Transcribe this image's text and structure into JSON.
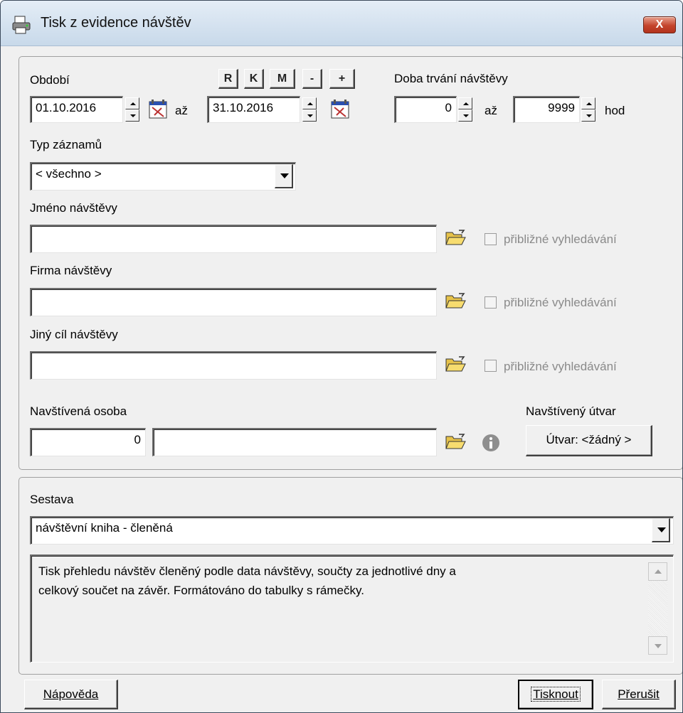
{
  "window": {
    "title": "Tisk z evidence návštěv",
    "close_label": "X"
  },
  "period": {
    "label": "Období",
    "from": "01.10.2016",
    "to_label": "až",
    "to": "31.10.2016",
    "quick_buttons": [
      "R",
      "K",
      "M",
      "-",
      "+"
    ]
  },
  "duration": {
    "label": "Doba trvání návštěvy",
    "from": "0",
    "to_label": "až",
    "to": "9999",
    "unit": "hod"
  },
  "record_type": {
    "label": "Typ záznamů",
    "value": "< všechno >"
  },
  "visitor_name": {
    "label": "Jméno návštěvy",
    "value": "",
    "approx_label": "přibližné vyhledávání"
  },
  "visitor_company": {
    "label": "Firma návštěvy",
    "value": "",
    "approx_label": "přibližné vyhledávání"
  },
  "other_target": {
    "label": "Jiný cíl návštěvy",
    "value": "",
    "approx_label": "přibližné vyhledávání"
  },
  "visited_person": {
    "label": "Navštívená osoba",
    "id": "0",
    "name": ""
  },
  "visited_unit": {
    "label": "Navštívený útvar",
    "button": "Útvar: <žádný >"
  },
  "report": {
    "label": "Sestava",
    "value": "návštěvní kniha - členěná",
    "description_line1": "Tisk přehledu návštěv členěný podle data návštěvy, součty za jednotlivé dny a",
    "description_line2": "celkový součet na závěr. Formátováno do tabulky s rámečky."
  },
  "footer": {
    "help": "Nápověda",
    "print": "Tisknout",
    "cancel": "Přerušit"
  },
  "colors": {
    "titlebar": "#c8d9ea",
    "close": "#c4442c",
    "window_bg": "#f0f0f0"
  },
  "icons": {
    "title": "printer-icon",
    "calendar": "calendar-icon",
    "folder": "open-folder-icon",
    "info": "info-icon"
  }
}
